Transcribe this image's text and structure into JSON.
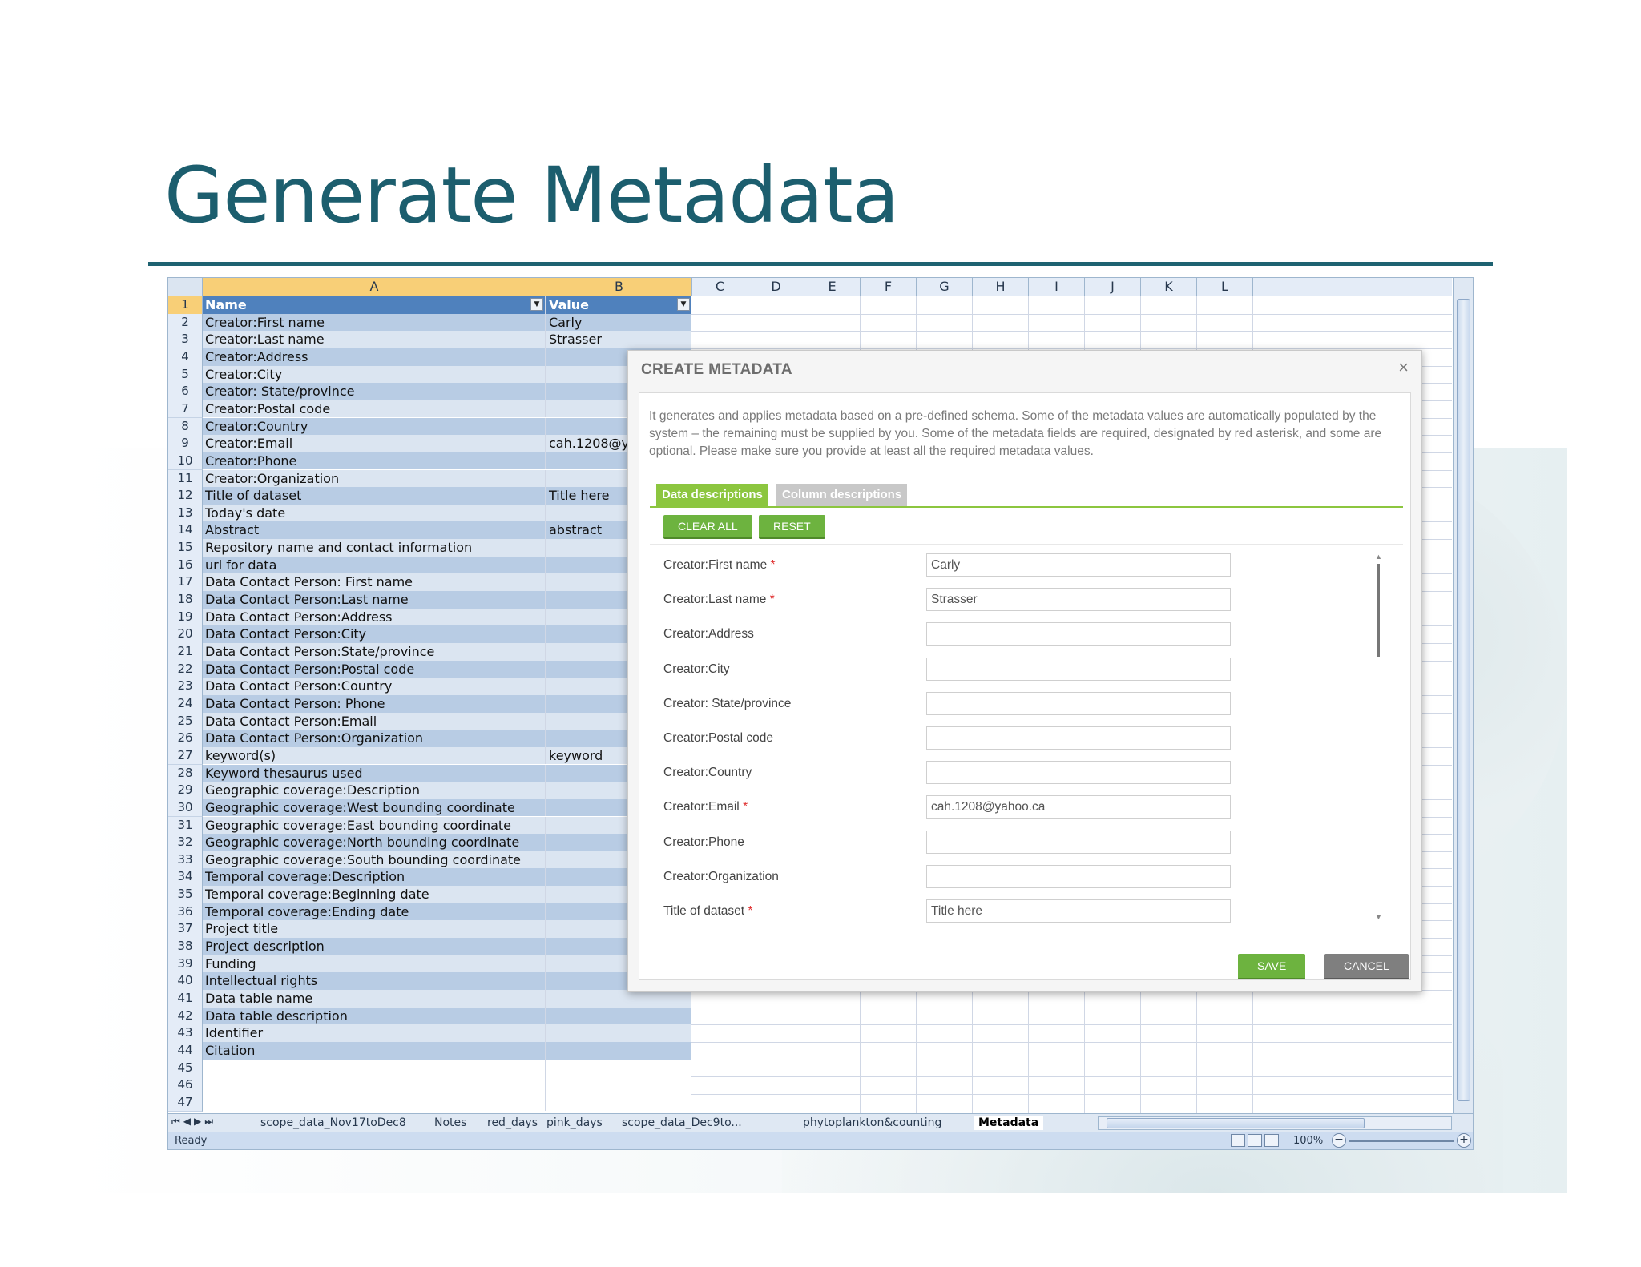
{
  "slide": {
    "title": "Generate Metadata"
  },
  "spreadsheet": {
    "columns": [
      "A",
      "B",
      "C",
      "D",
      "E",
      "F",
      "G",
      "H",
      "I",
      "J",
      "K",
      "L"
    ],
    "header": {
      "row": "1",
      "name": "Name",
      "value": "Value"
    },
    "rows": [
      {
        "n": "2",
        "a": "Creator:First name",
        "b": "Carly"
      },
      {
        "n": "3",
        "a": "Creator:Last name",
        "b": "Strasser"
      },
      {
        "n": "4",
        "a": "Creator:Address",
        "b": ""
      },
      {
        "n": "5",
        "a": "Creator:City",
        "b": ""
      },
      {
        "n": "6",
        "a": "Creator: State/province",
        "b": ""
      },
      {
        "n": "7",
        "a": "Creator:Postal code",
        "b": ""
      },
      {
        "n": "8",
        "a": "Creator:Country",
        "b": ""
      },
      {
        "n": "9",
        "a": "Creator:Email",
        "b": "cah.1208@y"
      },
      {
        "n": "10",
        "a": "Creator:Phone",
        "b": ""
      },
      {
        "n": "11",
        "a": "Creator:Organization",
        "b": ""
      },
      {
        "n": "12",
        "a": "Title of dataset",
        "b": "Title here"
      },
      {
        "n": "13",
        "a": "Today's date",
        "b": ""
      },
      {
        "n": "14",
        "a": "Abstract",
        "b": "abstract"
      },
      {
        "n": "15",
        "a": "Repository name and contact information",
        "b": ""
      },
      {
        "n": "16",
        "a": "url for data",
        "b": ""
      },
      {
        "n": "17",
        "a": "Data Contact Person: First name",
        "b": ""
      },
      {
        "n": "18",
        "a": "Data Contact Person:Last name",
        "b": ""
      },
      {
        "n": "19",
        "a": "Data Contact Person:Address",
        "b": ""
      },
      {
        "n": "20",
        "a": "Data Contact Person:City",
        "b": ""
      },
      {
        "n": "21",
        "a": "Data Contact Person:State/province",
        "b": ""
      },
      {
        "n": "22",
        "a": "Data Contact Person:Postal code",
        "b": ""
      },
      {
        "n": "23",
        "a": "Data Contact Person:Country",
        "b": ""
      },
      {
        "n": "24",
        "a": "Data Contact Person: Phone",
        "b": ""
      },
      {
        "n": "25",
        "a": "Data Contact Person:Email",
        "b": ""
      },
      {
        "n": "26",
        "a": "Data Contact Person:Organization",
        "b": ""
      },
      {
        "n": "27",
        "a": "keyword(s)",
        "b": "keyword"
      },
      {
        "n": "28",
        "a": "Keyword thesaurus used",
        "b": ""
      },
      {
        "n": "29",
        "a": "Geographic coverage:Description",
        "b": ""
      },
      {
        "n": "30",
        "a": "Geographic coverage:West bounding coordinate",
        "b": ""
      },
      {
        "n": "31",
        "a": "Geographic coverage:East bounding coordinate",
        "b": ""
      },
      {
        "n": "32",
        "a": "Geographic coverage:North bounding coordinate",
        "b": ""
      },
      {
        "n": "33",
        "a": "Geographic coverage:South bounding coordinate",
        "b": ""
      },
      {
        "n": "34",
        "a": "Temporal coverage:Description",
        "b": ""
      },
      {
        "n": "35",
        "a": "Temporal coverage:Beginning date",
        "b": ""
      },
      {
        "n": "36",
        "a": "Temporal coverage:Ending date",
        "b": ""
      },
      {
        "n": "37",
        "a": "Project title",
        "b": ""
      },
      {
        "n": "38",
        "a": "Project description",
        "b": ""
      },
      {
        "n": "39",
        "a": "Funding",
        "b": ""
      },
      {
        "n": "40",
        "a": "Intellectual rights",
        "b": ""
      },
      {
        "n": "41",
        "a": "Data table name",
        "b": ""
      },
      {
        "n": "42",
        "a": "Data table description",
        "b": ""
      },
      {
        "n": "43",
        "a": "Identifier",
        "b": ""
      },
      {
        "n": "44",
        "a": "Citation",
        "b": ""
      },
      {
        "n": "45",
        "a": "",
        "b": ""
      },
      {
        "n": "46",
        "a": "",
        "b": ""
      },
      {
        "n": "47",
        "a": "",
        "b": ""
      }
    ],
    "sheet_tabs": [
      "scope_data_Nov17toDec8",
      "Notes",
      "red_days",
      "pink_days",
      "scope_data_Dec9to...",
      "phytoplankton&counting",
      "Metadata"
    ],
    "active_sheet": "Metadata",
    "status": "Ready",
    "zoom": "100%"
  },
  "dialog": {
    "title": "CREATE METADATA",
    "close_glyph": "×",
    "description": "It generates and applies metadata based on a pre-defined schema. Some of the metadata values are automatically populated by the system – the remaining must be supplied by you. Some of the metadata fields are required, designated by red asterisk, and some are optional. Please make sure you provide at least all the required metadata values.",
    "tabs": [
      "Data descriptions",
      "Column descriptions"
    ],
    "clear_all": "CLEAR ALL",
    "reset": "RESET",
    "fields": [
      {
        "label": "Creator:First name",
        "required": true,
        "value": "Carly"
      },
      {
        "label": "Creator:Last name",
        "required": true,
        "value": "Strasser"
      },
      {
        "label": "Creator:Address",
        "required": false,
        "value": ""
      },
      {
        "label": "Creator:City",
        "required": false,
        "value": ""
      },
      {
        "label": "Creator: State/province",
        "required": false,
        "value": ""
      },
      {
        "label": "Creator:Postal code",
        "required": false,
        "value": ""
      },
      {
        "label": "Creator:Country",
        "required": false,
        "value": ""
      },
      {
        "label": "Creator:Email",
        "required": true,
        "value": "cah.1208@yahoo.ca"
      },
      {
        "label": "Creator:Phone",
        "required": false,
        "value": ""
      },
      {
        "label": "Creator:Organization",
        "required": false,
        "value": ""
      },
      {
        "label": "Title of dataset",
        "required": true,
        "value": "Title here"
      }
    ],
    "required_marker": "*",
    "save": "SAVE",
    "cancel": "CANCEL"
  },
  "colors": {
    "title": "#1c5e6e",
    "table_header": "#4f81bd",
    "band_dark": "#b8cce4",
    "band_light": "#dbe5f1",
    "green_button": "#6db33f",
    "required": "#e03030"
  }
}
